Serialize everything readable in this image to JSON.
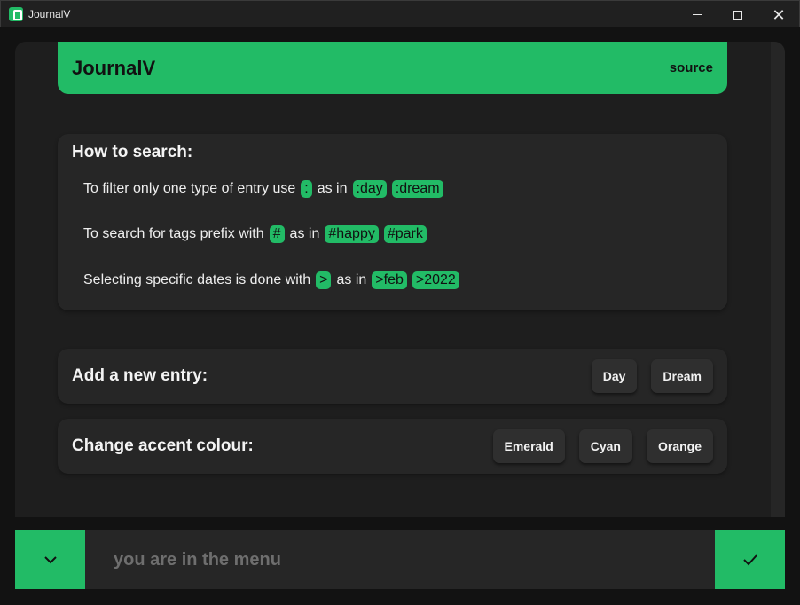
{
  "window": {
    "title": "JournalV",
    "icon": "journal-app-icon"
  },
  "header": {
    "title": "JournalV",
    "link": "source"
  },
  "search_help": {
    "title": "How to search:",
    "rows": [
      {
        "text": "To filter only one type of entry use",
        "operator": ":",
        "as_in": "as in",
        "examples": [
          ":day",
          ":dream"
        ]
      },
      {
        "text": "To search for tags prefix with",
        "operator": "#",
        "as_in": "as in",
        "examples": [
          "#happy",
          "#park"
        ]
      },
      {
        "text": "Selecting specific dates is done with",
        "operator": ">",
        "as_in": "as in",
        "examples": [
          ">feb",
          ">2022"
        ]
      }
    ]
  },
  "new_entry": {
    "label": "Add a new entry:",
    "buttons": [
      "Day",
      "Dream"
    ]
  },
  "accent": {
    "label": "Change accent colour:",
    "buttons": [
      "Emerald",
      "Cyan",
      "Orange"
    ]
  },
  "bottom_bar": {
    "status": "you are in the menu",
    "left_icon": "chevron-down-icon",
    "right_icon": "checkmark-icon"
  },
  "colors": {
    "accent": "#22bb66",
    "background": "#121212",
    "card": "#262626"
  }
}
